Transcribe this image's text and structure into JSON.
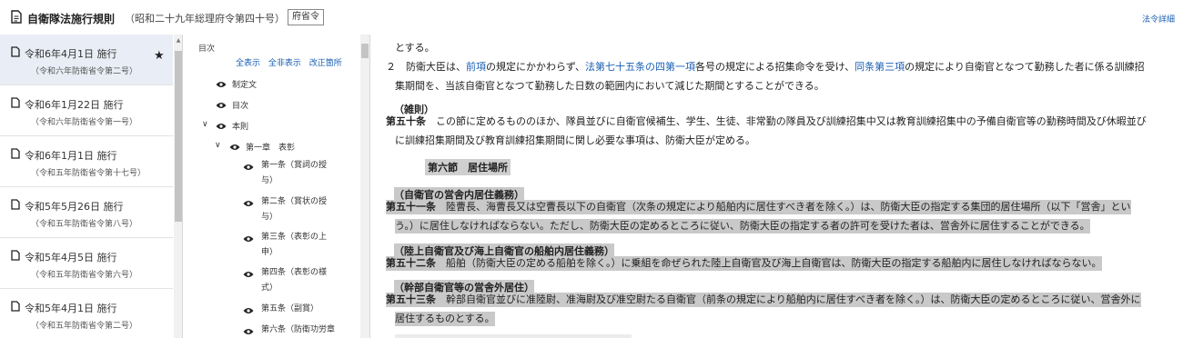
{
  "header": {
    "title": "自衛隊法施行規則",
    "subtitle": "（昭和二十九年総理府令第四十号）",
    "tag": "府省令",
    "detail_link": "法令詳細"
  },
  "revisions": [
    {
      "date": "令和6年4月1日 施行",
      "number": "（令和六年防衛省令第二号）",
      "active": true
    },
    {
      "date": "令和6年1月22日 施行",
      "number": "（令和六年防衛省令第一号）"
    },
    {
      "date": "令和6年1月1日 施行",
      "number": "（令和五年防衛省令第十七号）"
    },
    {
      "date": "令和5年5月26日 施行",
      "number": "（令和五年防衛省令第八号）"
    },
    {
      "date": "令和5年4月5日 施行",
      "number": "（令和五年防衛省令第六号）"
    },
    {
      "date": "令和5年4月1日 施行",
      "number": "（令和五年防衛省令第二号）"
    }
  ],
  "toc": {
    "label": "目次",
    "links": [
      "全表示",
      "全非表示",
      "改正箇所"
    ],
    "items": {
      "enact": "制定文",
      "contents": "目次",
      "main": "本則",
      "ch1": "第一章　表彰",
      "a1": "第一条（賞詞の授与）",
      "a2": "第二条（賞状の授与）",
      "a3": "第三条（表彰の上申）",
      "a4": "第四条（表彰の様式）",
      "a5": "第五条（副賞）",
      "a6": "第六条（防衛功労章"
    }
  },
  "main": {
    "line0": "とする。",
    "p2_num": "２",
    "p2_a": "防衛大臣は、",
    "p2_b": "前項",
    "p2_c": "の規定にかかわらず、",
    "p2_d": "法第七十五条の四第一項",
    "p2_e": "各号の規定による招集命令を受け、",
    "p2_f": "同条第三項",
    "p2_g": "の規定により自衛官となつて勤務した者に係る訓練招",
    "p2_line2": "集期間を、当該自衛官となつて勤務した日数の範囲内において減じた期間とすることができる。",
    "a50_cap": "（雑則）",
    "a50_num": "第五十条",
    "a50_l1": "この節に定めるもののほか、隊員並びに自衛官候補生、学生、生徒、非常勤の隊員及び訓練招集中又は教育訓練招集中の予備自衛官等の勤務時間及び休暇並び",
    "a50_l2": "に訓練招集期間及び教育訓練招集期間に関し必要な事項は、防衛大臣が定める。",
    "sec6": "第六節　居住場所",
    "a51_cap": "（自衛官の営舎内居住義務）",
    "a51_num": "第五十一条",
    "a51_l1": "陸曹長、海曹長又は空曹長以下の自衛官（次条の規定により船舶内に居住すべき者を除く。）は、防衛大臣の指定する集団的居住場所（以下「営舎」とい",
    "a51_l2": "う。）に居住しなければならない。ただし、防衛大臣の定めるところに従い、防衛大臣の指定する者の許可を受けた者は、営舎外に居住することができる。",
    "a52_cap": "（陸上自衛官及び海上自衛官の船舶内居住義務）",
    "a52_num": "第五十二条",
    "a52_l1": "船舶（防衛大臣の定める船舶を除く。）に乗組を命ぜられた陸上自衛官及び海上自衛官は、防衛大臣の指定する船舶内に居住しなければならない。",
    "a53_cap": "（幹部自衛官等の営舎外居住）",
    "a53_num": "第五十三条",
    "a53_l1": "幹部自衛官並びに准陸尉、准海尉及び准空尉たる自衛官（前条の規定により船舶内に居住すべき者を除く。）は、防衛大臣の定めるところに従い、営舎外に",
    "a53_l2": "居住するものとする。"
  }
}
